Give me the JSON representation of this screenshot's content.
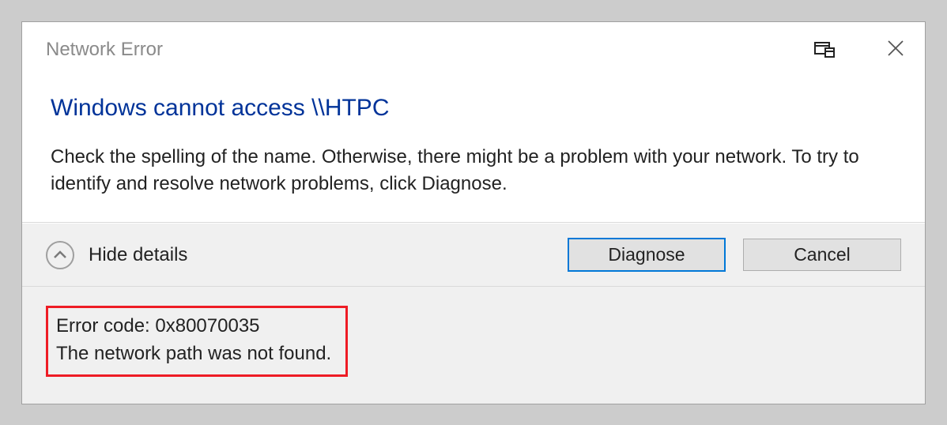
{
  "titlebar": {
    "title": "Network Error"
  },
  "main": {
    "heading": "Windows cannot access \\\\HTPC",
    "description": "Check the spelling of the name. Otherwise, there might be a problem with your network. To try to identify and resolve network problems, click Diagnose."
  },
  "actions": {
    "toggle_label": "Hide details",
    "diagnose_label": "Diagnose",
    "cancel_label": "Cancel"
  },
  "details": {
    "line1": "Error code: 0x80070035",
    "line2": "The network path was not found."
  }
}
